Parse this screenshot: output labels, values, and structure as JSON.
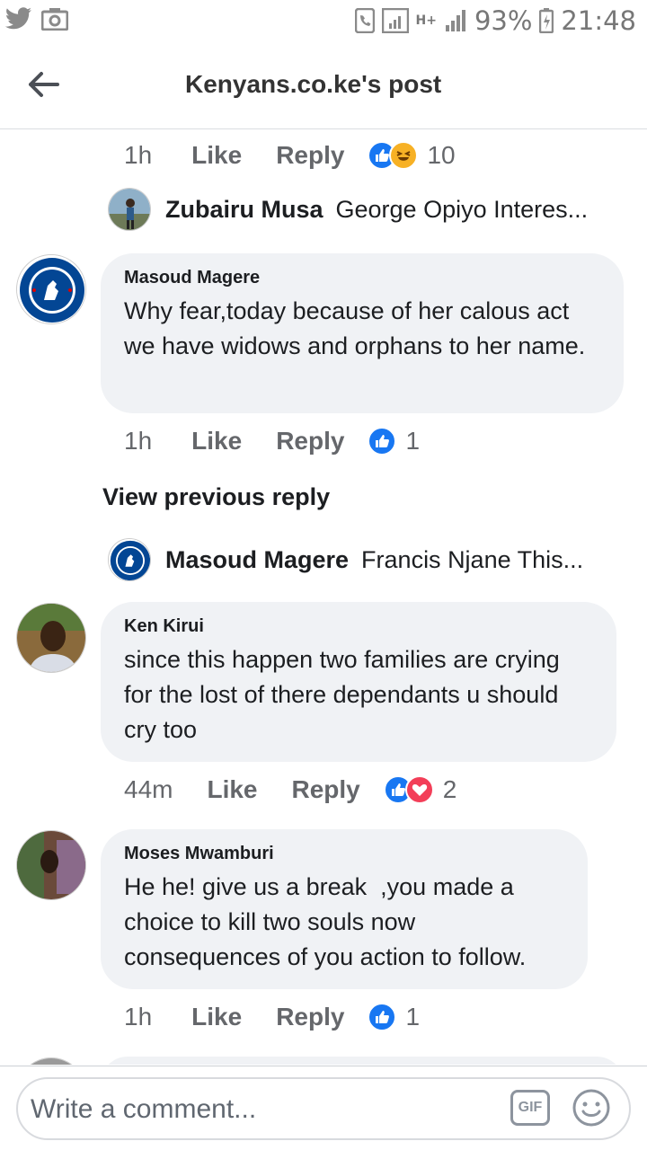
{
  "status_bar": {
    "battery": "93%",
    "time": "21:48",
    "network": "H+"
  },
  "header": {
    "title": "Kenyans.co.ke's post"
  },
  "comments": [
    {
      "time": "1h",
      "like_label": "Like",
      "reply_label": "Reply",
      "reaction_count": "10",
      "reactions": [
        "like-icon",
        "haha-icon"
      ],
      "reply_preview": {
        "name": "Zubairu Musa",
        "text": "George Opiyo Interes..."
      }
    },
    {
      "author": "Masoud Magere",
      "text": "Why fear,today because of her calous act we have widows and orphans to her name.",
      "time": "1h",
      "like_label": "Like",
      "reply_label": "Reply",
      "reaction_count": "1",
      "reactions": [
        "like-icon"
      ],
      "view_previous": "View previous reply",
      "reply_preview": {
        "name": "Masoud Magere",
        "text": "Francis Njane This..."
      }
    },
    {
      "author": "Ken Kirui",
      "text": "since this happen two families are crying for the lost of there dependants u should cry too",
      "time": "44m",
      "like_label": "Like",
      "reply_label": "Reply",
      "reaction_count": "2",
      "reactions": [
        "like-icon",
        "love-icon"
      ]
    },
    {
      "author": "Moses Mwamburi",
      "text": "He he! give us a break  ,you made a choice to kill two souls now consequences of you action to follow.",
      "time": "1h",
      "like_label": "Like",
      "reply_label": "Reply",
      "reaction_count": "1",
      "reactions": [
        "like-icon"
      ]
    }
  ],
  "composer": {
    "placeholder": "Write a comment...",
    "gif_label": "GIF"
  },
  "colors": {
    "like_blue": "#1877f2",
    "love_red": "#f33e58",
    "haha_yellow": "#f7b125",
    "bubble_bg": "#f0f2f5",
    "chelsea_blue": "#034694"
  }
}
